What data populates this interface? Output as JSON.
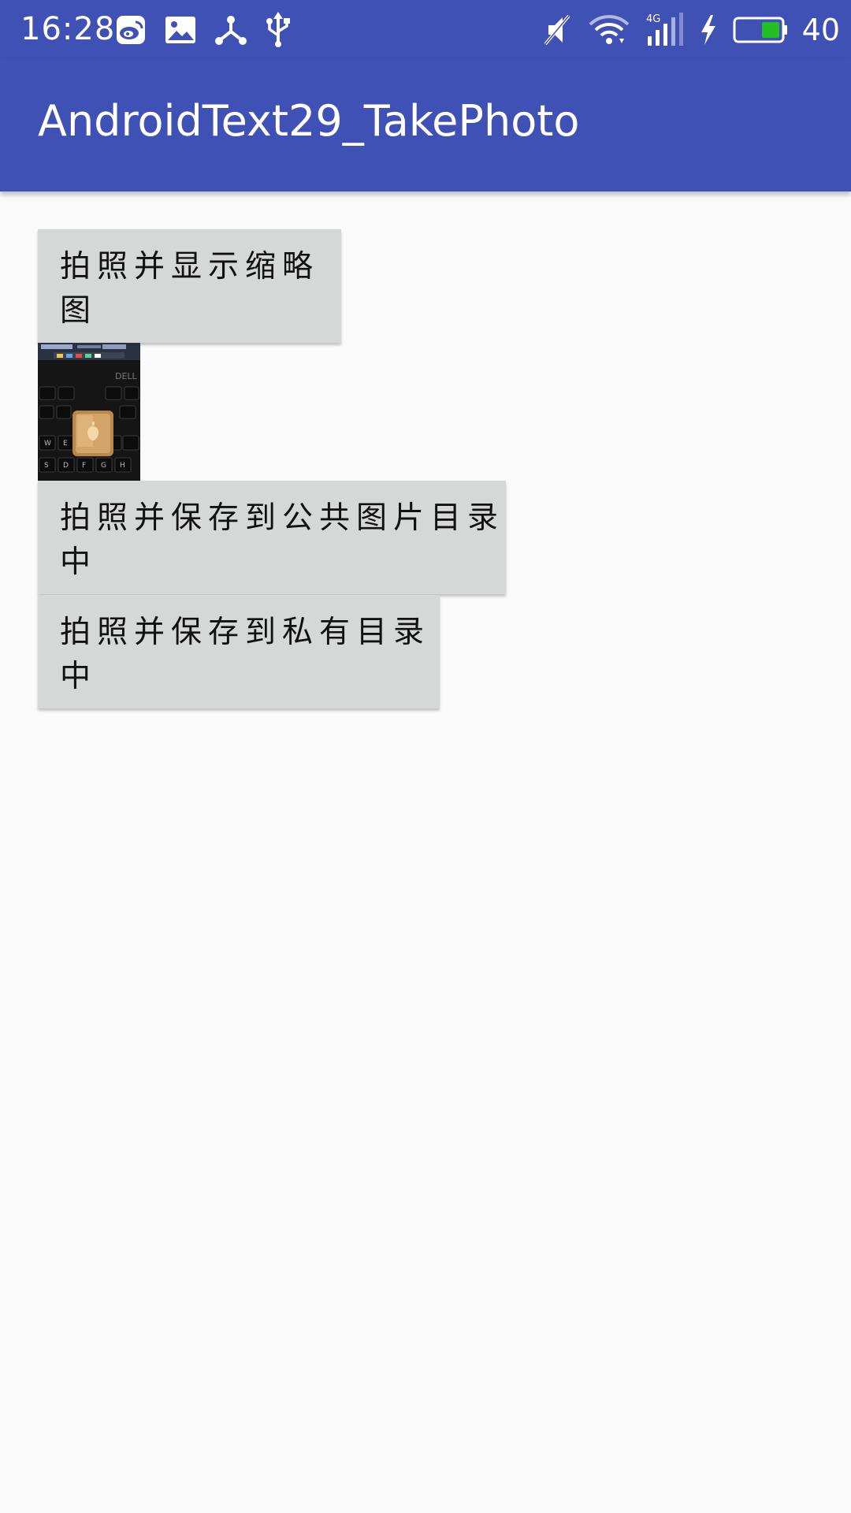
{
  "status_bar": {
    "time": "16:28",
    "battery_level": "40",
    "left_icons": [
      "weibo-icon",
      "image-icon",
      "share-icon",
      "usb-icon"
    ],
    "right_icons": [
      "mute-icon",
      "wifi-icon",
      "signal-4g-icon",
      "charging-icon",
      "battery-icon"
    ],
    "battery_fill_color": "#22c022"
  },
  "toolbar": {
    "title": "AndroidText29_TakePhoto",
    "background": "#3f51b5"
  },
  "main": {
    "buttons": [
      {
        "label": "拍照并显示缩略图"
      },
      {
        "label": "拍照并保存到公共图片目录中"
      },
      {
        "label": "拍照并保存到私有目录中"
      }
    ],
    "thumbnail": {
      "logo_text": "DELL",
      "keys": [
        "W",
        "E",
        "S",
        "D",
        "F",
        "G",
        "H"
      ]
    }
  }
}
